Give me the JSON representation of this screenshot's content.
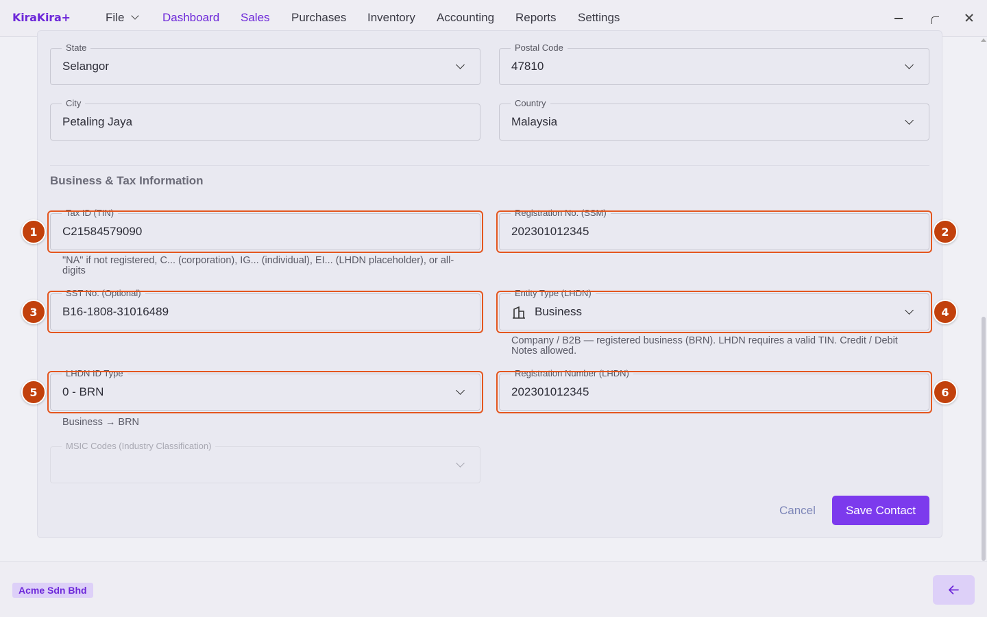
{
  "app": {
    "name": "KiraKira+"
  },
  "nav": {
    "file": "File",
    "items": [
      "Dashboard",
      "Sales",
      "Purchases",
      "Inventory",
      "Accounting",
      "Reports",
      "Settings"
    ],
    "active": "Sales"
  },
  "address": {
    "state": {
      "label": "State",
      "value": "Selangor"
    },
    "postal_code": {
      "label": "Postal Code",
      "value": "47810"
    },
    "city": {
      "label": "City",
      "value": "Petaling Jaya"
    },
    "country": {
      "label": "Country",
      "value": "Malaysia"
    }
  },
  "business": {
    "section_title": "Business & Tax Information",
    "tax_id": {
      "label": "Tax ID (TIN)",
      "value": "C21584579090",
      "helper": "\"NA\" if not registered, C... (corporation), IG... (individual), EI... (LHDN placeholder), or all-digits"
    },
    "registration_ssm": {
      "label": "Registration No. (SSM)",
      "value": "202301012345"
    },
    "sst": {
      "label": "SST No. (Optional)",
      "value": "B16-1808-31016489"
    },
    "entity_type": {
      "label": "Entity Type (LHDN)",
      "value": "Business",
      "icon": "building-icon",
      "helper": "Company / B2B — registered business (BRN). LHDN requires a valid TIN. Credit / Debit Notes allowed."
    },
    "lhdn_id_type": {
      "label": "LHDN ID Type",
      "value": "0 - BRN",
      "helper": "Business → BRN"
    },
    "registration_lhdn": {
      "label": "Registration Number (LHDN)",
      "value": "202301012345"
    },
    "msic": {
      "label": "MSIC Codes (Industry Classification)",
      "value": ""
    }
  },
  "annotations": [
    "1",
    "2",
    "3",
    "4",
    "5",
    "6"
  ],
  "actions": {
    "cancel": "Cancel",
    "save": "Save Contact"
  },
  "footer": {
    "company": "Acme Sdn Bhd",
    "back_icon": "arrow-left-icon"
  },
  "colors": {
    "accent": "#7c3aed",
    "highlight": "#e4561e",
    "badge": "#c2410c"
  }
}
